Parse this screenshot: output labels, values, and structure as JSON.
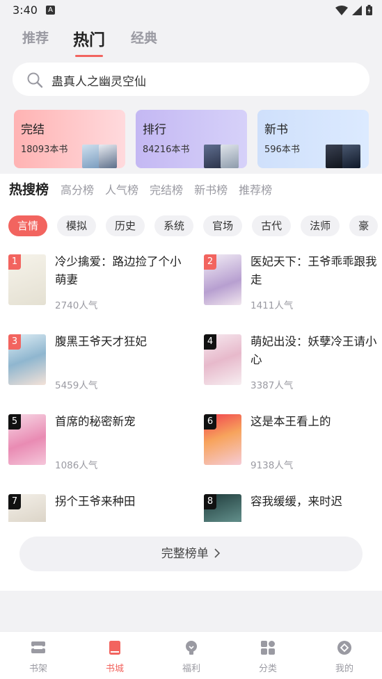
{
  "status_bar": {
    "time": "3:40",
    "a_icon": "A"
  },
  "top_tabs": [
    {
      "label": "推荐"
    },
    {
      "label": "热门"
    },
    {
      "label": "经典"
    }
  ],
  "search": {
    "value": "蛊真人之幽灵空仙",
    "icon": "search-icon"
  },
  "cards": [
    {
      "title": "完结",
      "count": "18093本书",
      "color": "#ffb3b3"
    },
    {
      "title": "排行",
      "count": "84216本书",
      "color": "#c4b8f3"
    },
    {
      "title": "新书",
      "count": "596本书",
      "color": "#cfe0fb"
    }
  ],
  "rank_tabs": [
    "热搜榜",
    "高分榜",
    "人气榜",
    "完结榜",
    "新书榜",
    "推荐榜"
  ],
  "chips": [
    "言情",
    "模拟",
    "历史",
    "系统",
    "官场",
    "古代",
    "法师",
    "豪"
  ],
  "books": [
    {
      "rank": "1",
      "title": "冷少擒爱：路边捡了个小萌妻",
      "popularity": "2740人气",
      "badge_color": "#f2645f"
    },
    {
      "rank": "2",
      "title": "医妃天下：王爷乖乖跟我走",
      "popularity": "1411人气",
      "badge_color": "#f2645f"
    },
    {
      "rank": "3",
      "title": "腹黑王爷天才狂妃",
      "popularity": "5459人气",
      "badge_color": "#f2645f"
    },
    {
      "rank": "4",
      "title": "萌妃出没：妖孽冷王请小心",
      "popularity": "3387人气",
      "badge_color": "#111111"
    },
    {
      "rank": "5",
      "title": "首席的秘密新宠",
      "popularity": "1086人气",
      "badge_color": "#111111"
    },
    {
      "rank": "6",
      "title": "这是本王看上的",
      "popularity": "9138人气",
      "badge_color": "#111111"
    },
    {
      "rank": "7",
      "title": "拐个王爷来种田",
      "popularity": "",
      "badge_color": "#111111"
    },
    {
      "rank": "8",
      "title": "容我缓缓，来时迟",
      "popularity": "",
      "badge_color": "#111111"
    }
  ],
  "full_list_button": "完整榜单",
  "bottom_nav": [
    {
      "label": "书架",
      "icon": "bookshelf-icon"
    },
    {
      "label": "书城",
      "icon": "bookstore-icon"
    },
    {
      "label": "福利",
      "icon": "bulb-icon"
    },
    {
      "label": "分类",
      "icon": "category-icon"
    },
    {
      "label": "我的",
      "icon": "profile-icon"
    }
  ],
  "colors": {
    "accent": "#f2645f",
    "muted": "#9a9aa2"
  }
}
